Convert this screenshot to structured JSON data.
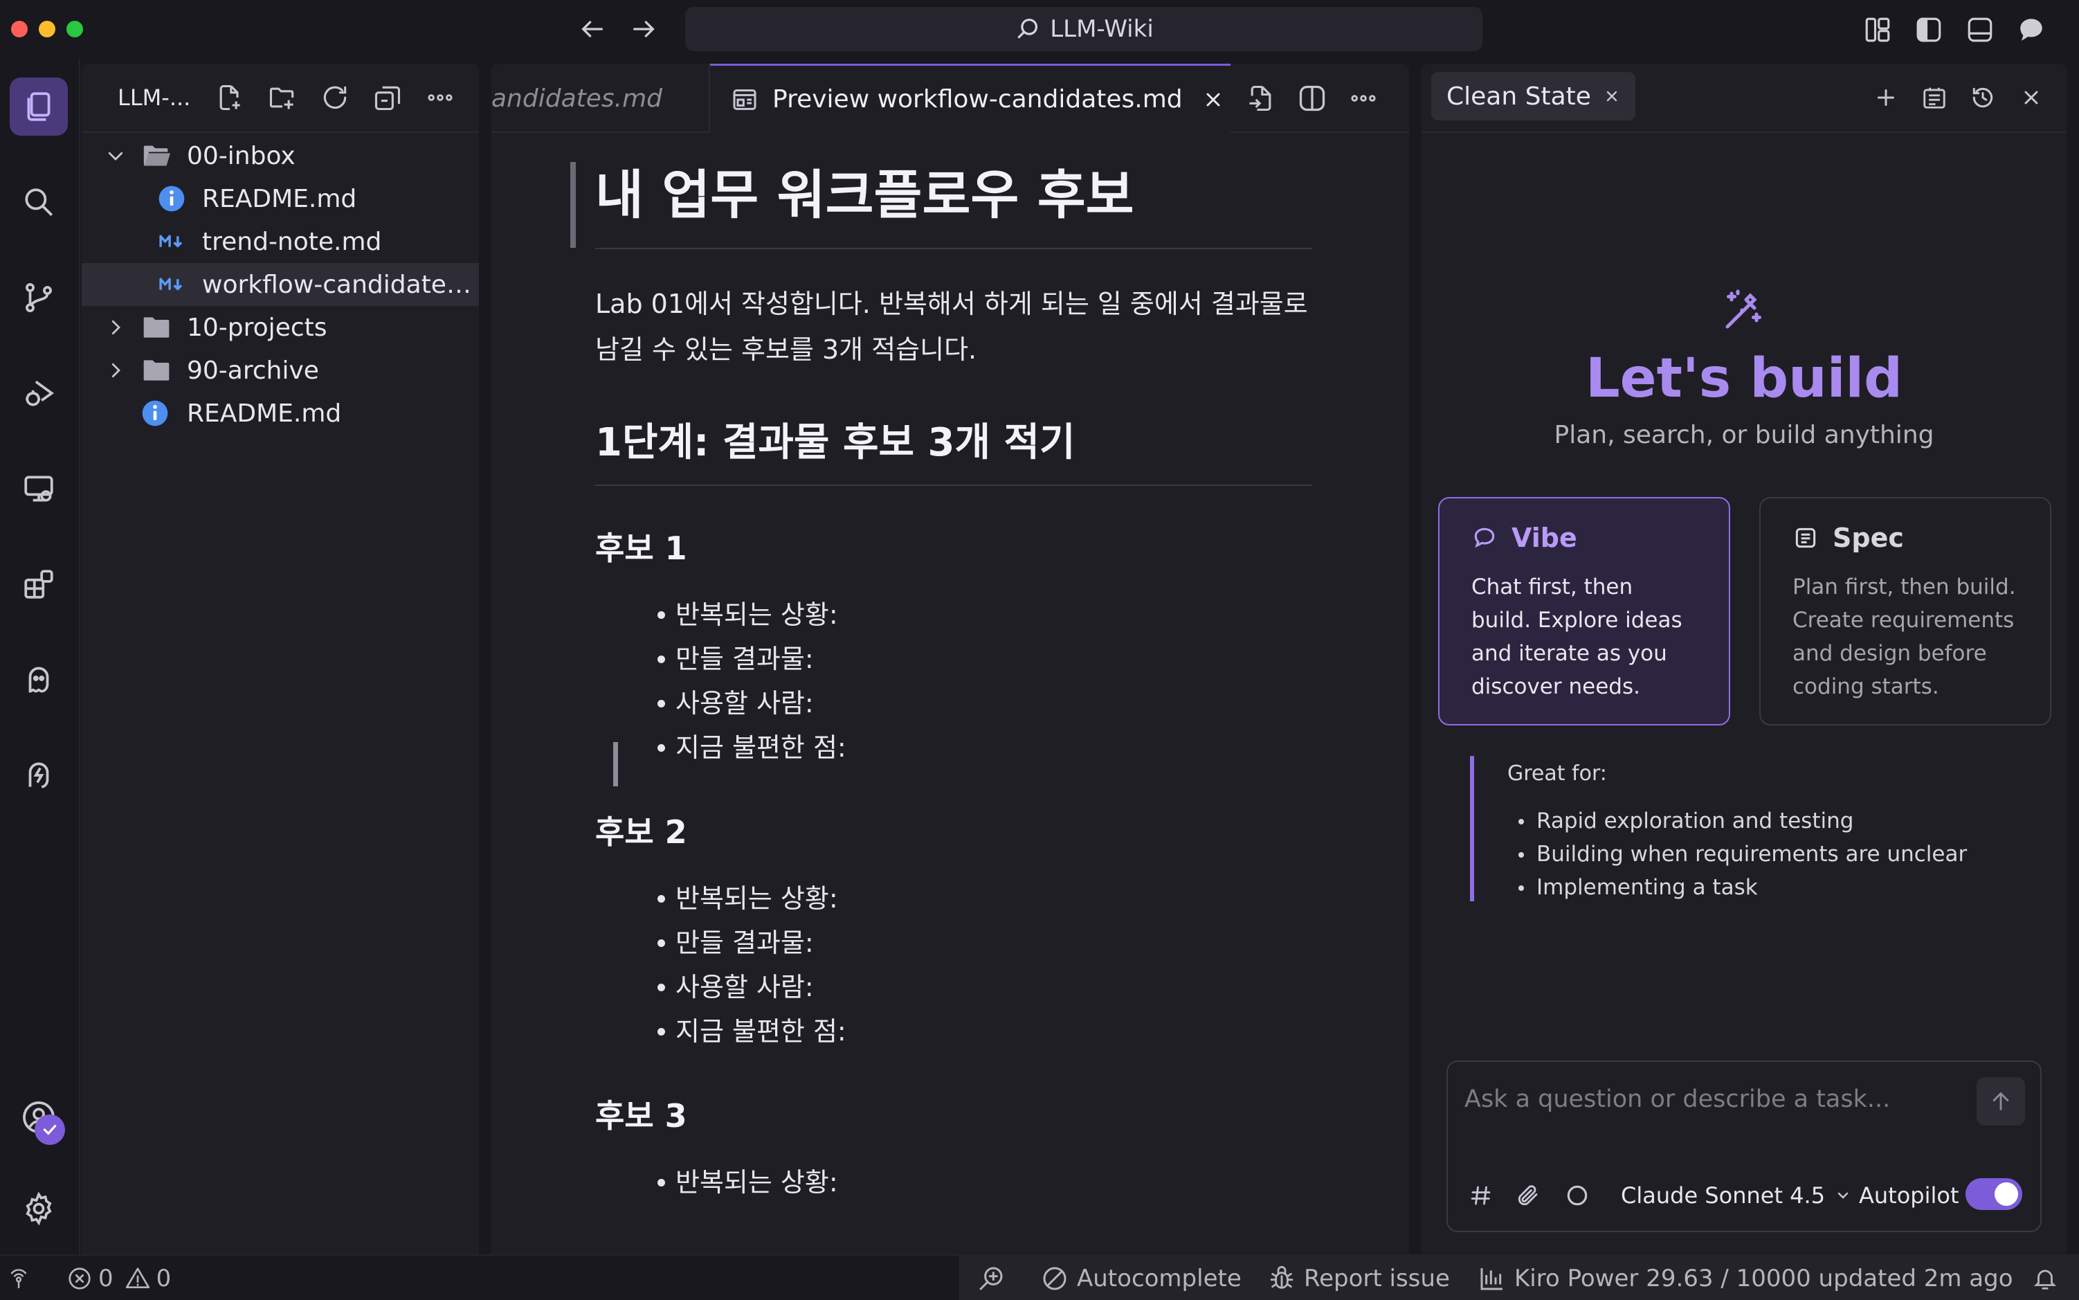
{
  "window": {
    "title": "LLM-Wiki"
  },
  "colors": {
    "accent": "#7c5cd8",
    "accent_light": "#a98bf0",
    "background": "#19181e",
    "panel": "#1f1e25"
  },
  "explorer": {
    "title": "LLM-...",
    "items": [
      {
        "label": "00-inbox",
        "type": "folder",
        "expanded": true,
        "depth": 0
      },
      {
        "label": "README.md",
        "type": "info-file",
        "depth": 1
      },
      {
        "label": "trend-note.md",
        "type": "markdown-file",
        "depth": 1
      },
      {
        "label": "workflow-candidates...",
        "type": "markdown-file",
        "depth": 1,
        "selected": true
      },
      {
        "label": "10-projects",
        "type": "folder",
        "expanded": false,
        "depth": 0
      },
      {
        "label": "90-archive",
        "type": "folder",
        "expanded": false,
        "depth": 0
      },
      {
        "label": "README.md",
        "type": "info-file",
        "depth": 0
      }
    ]
  },
  "editor": {
    "tabs": [
      {
        "label": "andidates.md",
        "active": false
      },
      {
        "label": "Preview workflow-candidates.md",
        "active": true
      }
    ],
    "doc": {
      "h1": "내 업무 워크플로우 후보",
      "intro": "Lab 01에서 작성합니다. 반복해서 하게 되는 일 중에서 결과물로 남길 수 있는 후보를 3개 적습니다.",
      "h2": "1단계: 결과물 후보 3개 적기",
      "candidates": [
        {
          "title": "후보 1",
          "fields": [
            "반복되는 상황:",
            "만들 결과물:",
            "사용할 사람:",
            "지금 불편한 점:"
          ]
        },
        {
          "title": "후보 2",
          "fields": [
            "반복되는 상황:",
            "만들 결과물:",
            "사용할 사람:",
            "지금 불편한 점:"
          ]
        },
        {
          "title": "후보 3",
          "fields": [
            "반복되는 상황:"
          ]
        }
      ]
    }
  },
  "chat": {
    "tab_label": "Clean State",
    "hero_title": "Let's build",
    "hero_subtitle": "Plan, search, or build anything",
    "modes": [
      {
        "name": "Vibe",
        "description": "Chat first, then build. Explore ideas and iterate as you discover needs.",
        "selected": true
      },
      {
        "name": "Spec",
        "description": "Plan first, then build. Create requirements and design before coding starts.",
        "selected": false
      }
    ],
    "great_for": {
      "title": "Great for:",
      "items": [
        "Rapid exploration and testing",
        "Building when requirements are unclear",
        "Implementing a task"
      ]
    },
    "input_placeholder": "Ask a question or describe a task...",
    "model": "Claude Sonnet 4.5",
    "autopilot_label": "Autopilot",
    "autopilot_on": true
  },
  "status": {
    "errors": "0",
    "warnings": "0",
    "autocomplete": "Autocomplete",
    "report_issue": "Report issue",
    "kiro_power": "Kiro Power 29.63 / 10000 updated 2m ago"
  }
}
